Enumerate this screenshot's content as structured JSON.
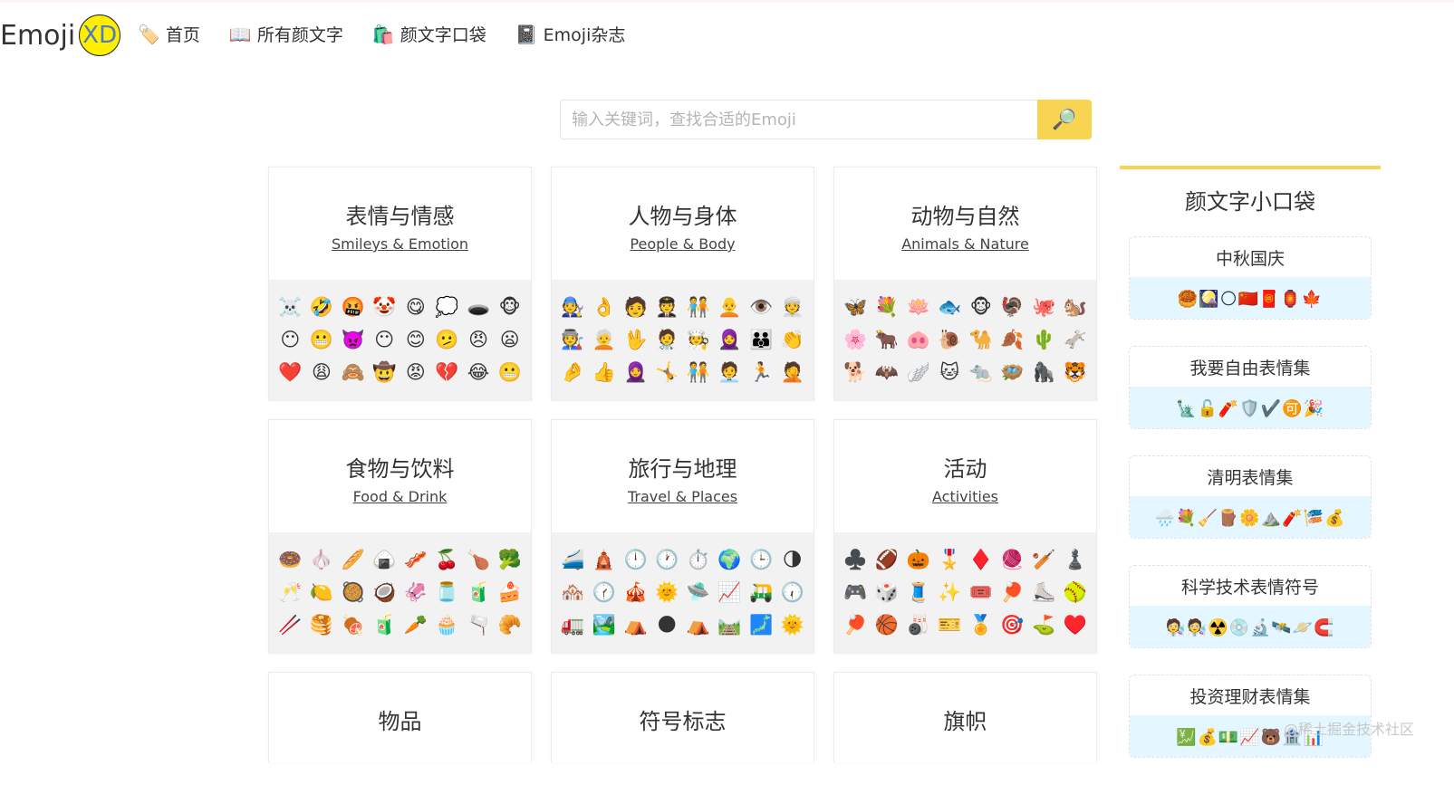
{
  "header": {
    "logo_text": "Emoji",
    "logo_badge": "XD",
    "nav": [
      {
        "icon": "🏷️",
        "label": "首页"
      },
      {
        "icon": "📖",
        "label": "所有颜文字"
      },
      {
        "icon": "🛍️",
        "label": "颜文字口袋"
      },
      {
        "icon": "📓",
        "label": "Emoji杂志"
      }
    ]
  },
  "search": {
    "placeholder": "输入关键词，查找合适的Emoji",
    "button_icon": "🔎"
  },
  "categories": [
    {
      "title": "表情与情感",
      "subtitle": "Smileys & Emotion",
      "emojis": "☠️🤣🤬🤡😋💭🕳️🐵😶😬👿😶😊🫤😠😦❤️😩🙈🤠😡💔😂😬"
    },
    {
      "title": "人物与身体",
      "subtitle": "People & Body",
      "emojis": "🧑‍🔧👌🧑🧑‍✈️🧑‍🤝‍🧑🧑‍🦲👁️👳🧑‍🏭🧑‍🦳🖖🧑‍⚕️🧑‍🍳🧕👪👏🤌👍🧕🤸🧑‍🤝‍🧑🧑‍💼🏃🤦"
    },
    {
      "title": "动物与自然",
      "subtitle": "Animals & Nature",
      "emojis": "🦋💐🪷🐟🐵🦃🐙🐿️🌸🐂🐽🐌🐪🍂🌵🫏🐕🦇🪽🐱🐀🪺🦍🐯"
    },
    {
      "title": "食物与饮料",
      "subtitle": "Food & Drink",
      "emojis": "🍩🧄🥖🍙🥓🍒🍗🥦🥂🍋🥘🥥🦑🫙🧃🍰🥢🥞🍖🧃🥕🧁🫗🥐"
    },
    {
      "title": "旅行与地理",
      "subtitle": "Travel & Places",
      "emojis": "🚄🛕🕛🕐⏱️🌍🕒🌗🏘️🕜🎪🌞🛸📈🛺🕡🚛🏞️⛺🌑⛺🛤️🗾🌞"
    },
    {
      "title": "活动",
      "subtitle": "Activities",
      "emojis": "♣️🏈🎃🎖️♦️🧶🏏♟️🎮🎲🧵✨🎟️🏓⛸️🥎🏓🏀🎳🎫🏅🎯⛳♥️"
    },
    {
      "title": "物品",
      "subtitle": "",
      "emojis": ""
    },
    {
      "title": "符号标志",
      "subtitle": "",
      "emojis": ""
    },
    {
      "title": "旗帜",
      "subtitle": "",
      "emojis": ""
    }
  ],
  "sidebar": {
    "title": "颜文字小口袋",
    "packs": [
      {
        "title": "中秋国庆",
        "emojis": "🥮🎑🌕🇨🇳🧧🏮🍁"
      },
      {
        "title": "我要自由表情集",
        "emojis": "🗽🔓🧨🛡️✔️🉑🎉"
      },
      {
        "title": "清明表情集",
        "emojis": "🌧️💐🧹🪵🌼⛰️🧨🎏💰"
      },
      {
        "title": "科学技术表情符号",
        "emojis": "🧑‍🔬🧑‍🔬☢️💿🔬🛰️🪐🧲"
      },
      {
        "title": "投资理财表情集",
        "emojis": "💹💰💵📈🐻🏦📊"
      }
    ]
  },
  "watermark": "@稀土掘金技术社区",
  "colors": {
    "accent": "#f7d451",
    "logo_badge": "#ffee00",
    "pack_bg": "#e4f6ff"
  }
}
